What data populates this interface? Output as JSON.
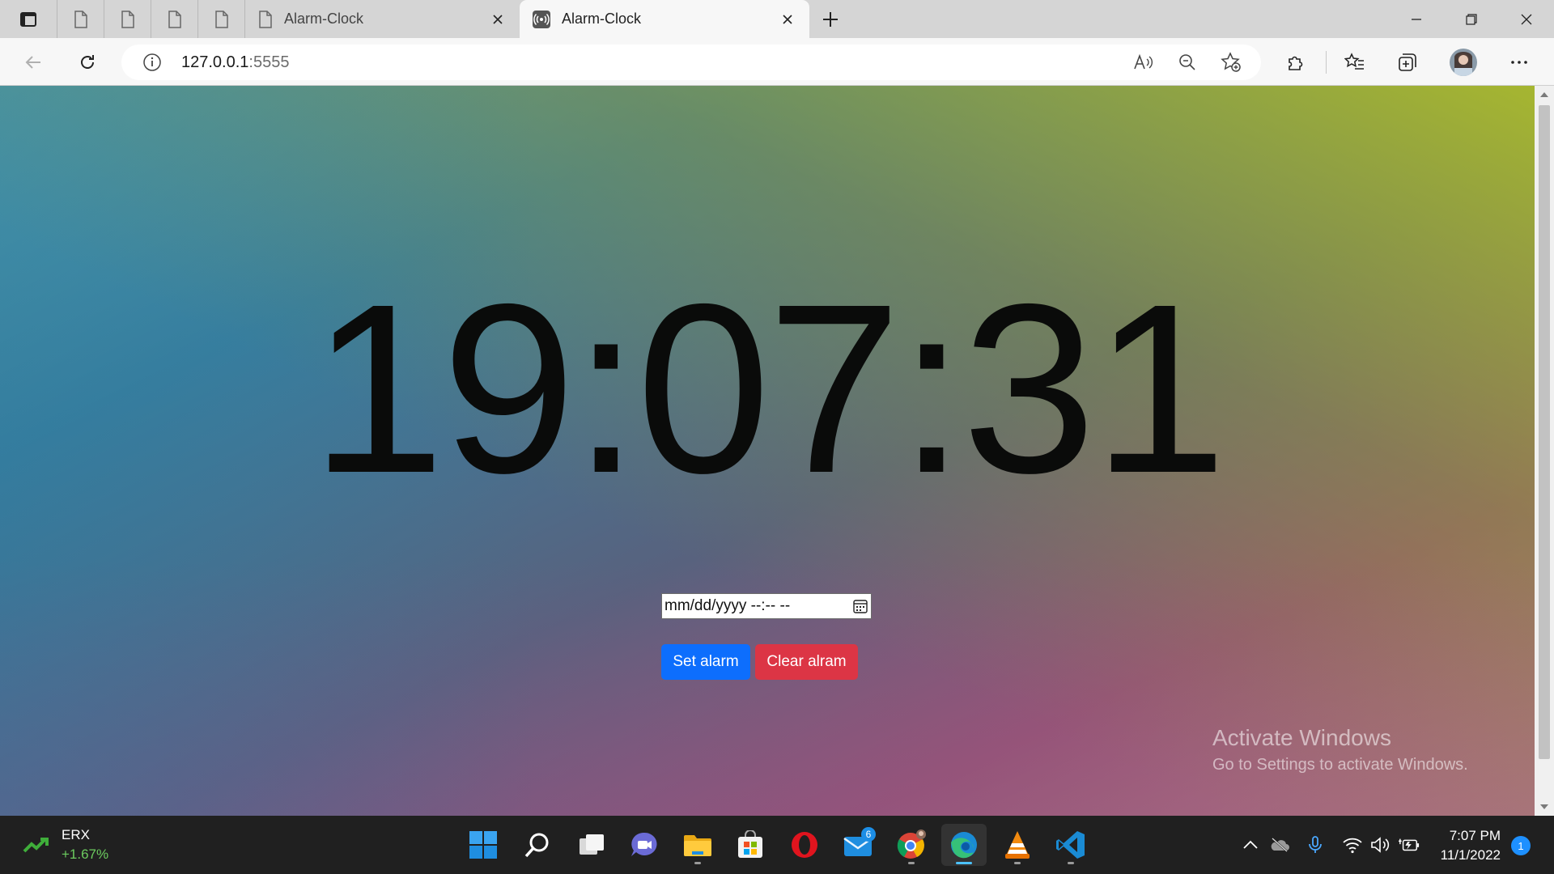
{
  "browser": {
    "tabs": [
      {
        "title": "Alarm-Clock",
        "active": false
      },
      {
        "title": "Alarm-Clock",
        "active": true
      }
    ],
    "address": {
      "host": "127.0.0.1",
      "port": ":5555"
    }
  },
  "page": {
    "clock": "19:07:31",
    "datetime_placeholder": "mm/dd/yyyy --:-- --",
    "set_alarm_label": "Set alarm",
    "clear_alarm_label": "Clear alram",
    "set_color": "#0d6efd",
    "clear_color": "#dc3545",
    "watermark": {
      "title": "Activate Windows",
      "subtitle": "Go to Settings to activate Windows."
    }
  },
  "taskbar": {
    "stock": {
      "symbol": "ERX",
      "change": "+1.67%"
    },
    "apps": [
      "windows-start",
      "search",
      "task-view",
      "teams-chat",
      "file-explorer",
      "microsoft-store",
      "opera",
      "mail",
      "chrome",
      "edge",
      "vlc",
      "vscode"
    ],
    "mail_badge": "6",
    "time": "7:07 PM",
    "date": "11/1/2022",
    "notification_count": "1"
  }
}
